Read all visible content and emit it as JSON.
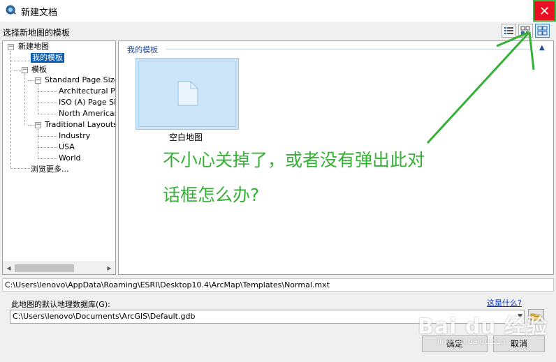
{
  "window": {
    "title": "新建文档",
    "close_glyph": "✕"
  },
  "header": {
    "subtitle": "选择新地图的模板",
    "view_buttons": [
      {
        "name": "details-view-icon"
      },
      {
        "name": "list-view-icon"
      },
      {
        "name": "thumbnail-view-icon",
        "active": true
      }
    ]
  },
  "tree": {
    "root_label": "新建地图",
    "my_templates": "我的模板",
    "templates_label": "模板",
    "standard_sizes": "Standard Page Sizes",
    "standard_children": [
      "Architectural Page Sizes",
      "ISO (A) Page Sizes",
      "North American (ANSI) Page Sizes"
    ],
    "traditional_layouts": "Traditional Layouts",
    "traditional_children": [
      "Industry",
      "USA",
      "World"
    ],
    "browse_more": "浏览更多..."
  },
  "content": {
    "section_title": "我的模板",
    "template_label": "空白地图"
  },
  "annotation": {
    "line1": "不小心关掉了，或者没有弹出此对",
    "line2": "话框怎么办?"
  },
  "footer": {
    "template_path": "C:\\Users\\lenovo\\AppData\\Roaming\\ESRI\\Desktop10.4\\ArcMap\\Templates\\Normal.mxt",
    "db_label": "此地图的默认地理数据库(G):",
    "help_link": "这是什么?",
    "db_path": "C:\\Users\\lenovo\\Documents\\ArcGIS\\Default.gdb",
    "ok_label": "确定",
    "cancel_label": "取消"
  },
  "watermark": {
    "big": "Bai du 经验",
    "small": "jingyan.baidu.com"
  },
  "colors": {
    "close_red": "#e81123",
    "annotation_green": "#36b036",
    "selection_blue": "#0a5fb4"
  }
}
